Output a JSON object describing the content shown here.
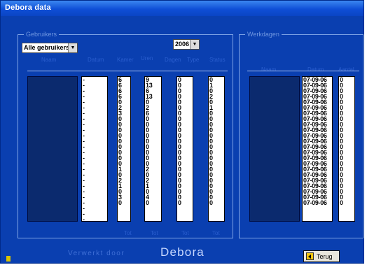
{
  "window": {
    "title": "Debora data"
  },
  "left_group": {
    "legend": "Gebruikers",
    "user_filter": {
      "selected": "Alle gebruikers"
    },
    "year_filter": {
      "selected": "2006"
    },
    "headers": [
      "Naam",
      "Datum",
      "Kamer",
      "Uren",
      "Dagen",
      "Type",
      "Status"
    ],
    "col_dash": [
      "-",
      "-",
      "-",
      "-",
      "-",
      "-",
      "-",
      "-",
      "-",
      "-",
      "-",
      "-",
      "-",
      "-",
      "-",
      "-",
      "-",
      "-",
      "-",
      "-",
      "-",
      "-",
      "-",
      "-",
      "-",
      "-"
    ],
    "col_a": [
      "6",
      "6",
      "6",
      "6",
      "0",
      "2",
      "3",
      "0",
      "0",
      "0",
      "0",
      "0",
      "0",
      "0",
      "0",
      "0",
      "1",
      "0",
      "2",
      "1",
      "0",
      "3",
      "0"
    ],
    "col_b": [
      "9",
      "13",
      "6",
      "13",
      "0",
      "2",
      "6",
      "0",
      "0",
      "0",
      "0",
      "0",
      "0",
      "0",
      "0",
      "0",
      "2",
      "0",
      "2",
      "1",
      "0",
      "4",
      "0"
    ],
    "col_c": [
      "0",
      "0",
      "0",
      "0",
      "0",
      "0",
      "0",
      "0",
      "0",
      "0",
      "0",
      "0",
      "0",
      "0",
      "0",
      "0",
      "0",
      "0",
      "0",
      "0",
      "0",
      "0",
      "0"
    ],
    "col_d": [
      "0",
      "1",
      "0",
      "2",
      "0",
      "1",
      "0",
      "0",
      "0",
      "0",
      "0",
      "0",
      "0",
      "0",
      "0",
      "0",
      "0",
      "0",
      "0",
      "0",
      "0",
      "0",
      "0"
    ],
    "footers": [
      "Tot",
      "Tot",
      "Tot",
      "Tot"
    ]
  },
  "right_group": {
    "legend": "Werkdagen",
    "headers": [
      "Naam",
      "Datum",
      "Aantal"
    ],
    "dates": [
      "07-09-06",
      "07-09-06",
      "07-09-06",
      "07-09-06",
      "07-09-06",
      "07-09-06",
      "07-09-06",
      "07-09-06",
      "07-09-06",
      "07-09-06",
      "07-09-06",
      "07-09-06",
      "07-09-06",
      "07-09-06",
      "07-09-06",
      "07-09-06",
      "07-09-06",
      "07-09-06",
      "07-09-06",
      "07-09-06",
      "07-09-06",
      "07-09-06",
      "07-09-06"
    ],
    "counts": [
      "0",
      "0",
      "0",
      "0",
      "0",
      "0",
      "0",
      "0",
      "0",
      "0",
      "0",
      "0",
      "0",
      "0",
      "0",
      "0",
      "0",
      "0",
      "0",
      "0",
      "0",
      "0",
      "0"
    ]
  },
  "footer": {
    "text": "Verwerkt door",
    "name": "Debora",
    "back_label": "Terug"
  },
  "colors": {
    "background": "#0a3fb0",
    "navy": "#0b2a6e",
    "accent": "#2a5ecf"
  },
  "icons": [
    "back-arrow-icon",
    "dropdown-arrow-icon",
    "info-icon"
  ]
}
